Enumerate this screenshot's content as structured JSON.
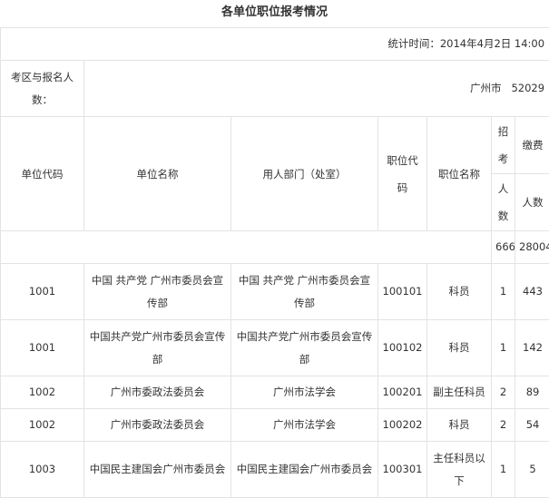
{
  "page_title": "各单位职位报考情况",
  "stat_time": "统计时间：2014年4月2日  14:00",
  "summary": {
    "label": "考区与报名人数：",
    "city": "广州市",
    "count": "52029"
  },
  "headers": {
    "unit_code": "单位代码",
    "unit_name": "单位名称",
    "dept": "用人部门（处室）",
    "pos_code": "职位代码",
    "pos_name": "职位名称",
    "zhao": "招考",
    "pay": "缴费",
    "renshu": "人数",
    "renshu2": "人数"
  },
  "totals": {
    "recruit": "666",
    "paid": "28004"
  },
  "rows": [
    {
      "unit_code": "1001",
      "unit_name": "中国 共产党 广州市委员会宣传部",
      "dept": "中国 共产党 广州市委员会宣传部",
      "pos_code": "100101",
      "pos_name": "科员",
      "recruit": "1",
      "paid": "443"
    },
    {
      "unit_code": "1001",
      "unit_name": "中国共产党广州市委员会宣传部",
      "dept": "中国共产党广州市委员会宣传部",
      "pos_code": "100102",
      "pos_name": "科员",
      "recruit": "1",
      "paid": "142"
    },
    {
      "unit_code": "1002",
      "unit_name": "广州市委政法委员会",
      "dept": "广州市法学会",
      "pos_code": "100201",
      "pos_name": "副主任科员",
      "recruit": "2",
      "paid": "89"
    },
    {
      "unit_code": "1002",
      "unit_name": "广州市委政法委员会",
      "dept": "广州市法学会",
      "pos_code": "100202",
      "pos_name": "科员",
      "recruit": "2",
      "paid": "54"
    },
    {
      "unit_code": "1003",
      "unit_name": "中国民主建国会广州市委员会",
      "dept": "中国民主建国会广州市委员会",
      "pos_code": "100301",
      "pos_name": "主任科员以下",
      "recruit": "1",
      "paid": "5"
    }
  ]
}
